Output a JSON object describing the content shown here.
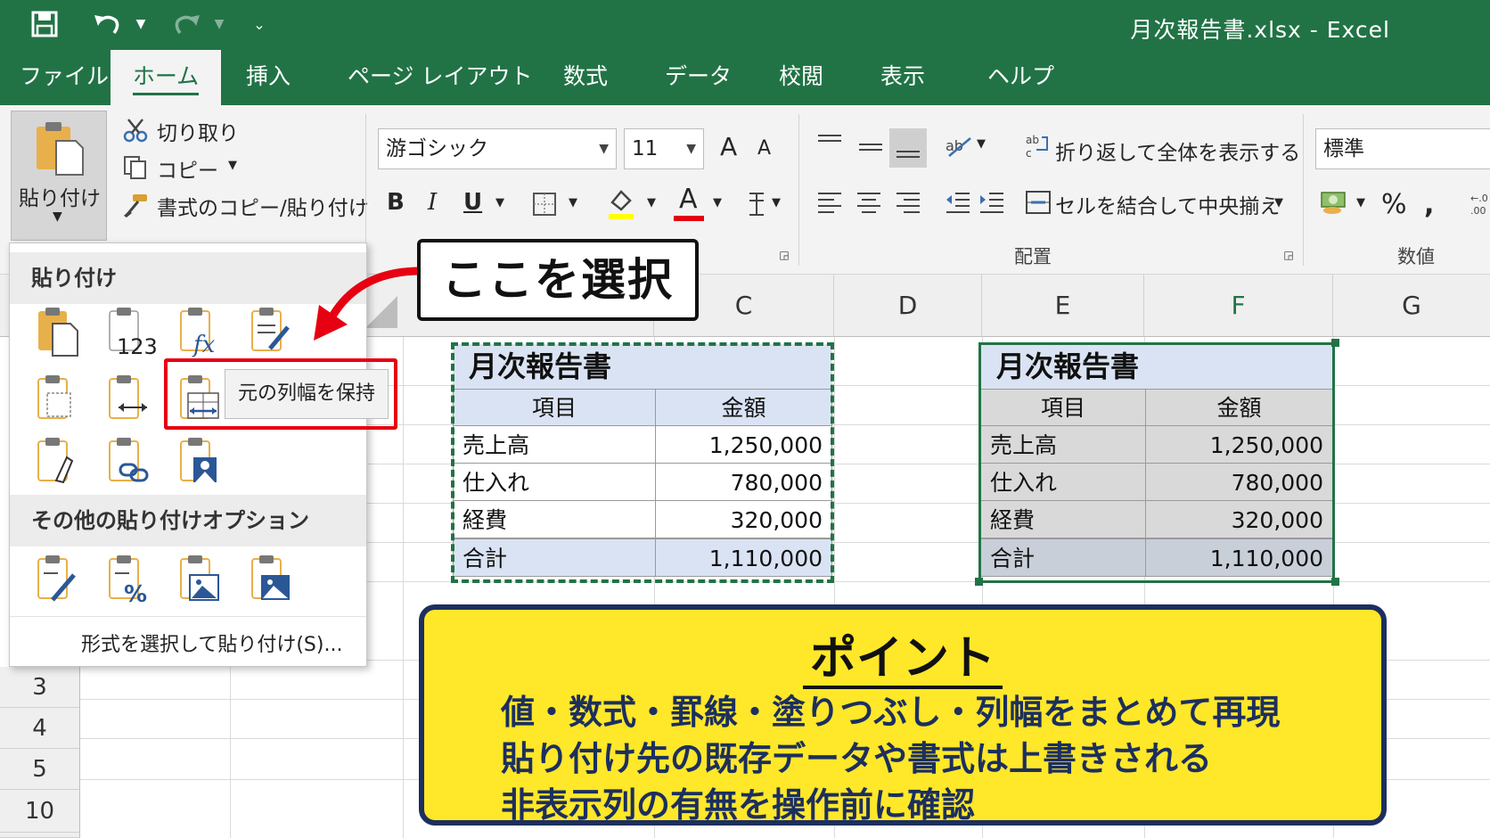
{
  "window": {
    "title": "月次報告書.xlsx  -  Excel"
  },
  "tabs": [
    {
      "label": "ファイル"
    },
    {
      "label": "ホーム"
    },
    {
      "label": "挿入"
    },
    {
      "label": "ページ レイアウト"
    },
    {
      "label": "数式"
    },
    {
      "label": "データ"
    },
    {
      "label": "校閲"
    },
    {
      "label": "表示"
    },
    {
      "label": "ヘルプ"
    }
  ],
  "ribbon": {
    "paste_label": "貼り付け",
    "cut_label": "切り取り",
    "copy_label": "コピー",
    "format_painter_label": "書式のコピー/貼り付け",
    "font_name": "游ゴシック",
    "font_size": "11",
    "bold": "B",
    "italic": "I",
    "underline": "U",
    "font_color_glyph": "A",
    "grow_font": "A",
    "shrink_font": "A",
    "wrap_text_label": "折り返して全体を表示する",
    "merge_center_label": "セルを結合して中央揃え",
    "alignment_group_label": "配置",
    "number_format": "標準",
    "percent": "%",
    "comma": "9",
    "number_group_label": "数値",
    "colors": {
      "highlight": "#ffff00",
      "font": "#e60012"
    }
  },
  "paste_menu": {
    "section1_title": "貼り付け",
    "section2_title": "その他の貼り付けオプション",
    "icon_values_text": "123",
    "icon_formula_text": "fx",
    "percent_text": "%",
    "special_link": "形式を選択して貼り付け(S)...",
    "tooltip": "元の列幅を保持"
  },
  "callout": {
    "text": "ここを選択"
  },
  "sheet": {
    "columns": [
      "C",
      "D",
      "E",
      "F",
      "G"
    ],
    "rows": [
      "3",
      "4",
      "5",
      "10"
    ]
  },
  "source_table": {
    "title": "月次報告書",
    "headers": [
      "項目",
      "金額"
    ],
    "rows": [
      {
        "item": "売上高",
        "amount": "1,250,000"
      },
      {
        "item": "仕入れ",
        "amount": "780,000"
      },
      {
        "item": "経費",
        "amount": "320,000"
      },
      {
        "item": "合計",
        "amount": "1,110,000"
      }
    ]
  },
  "dest_table": {
    "title": "月次報告書",
    "headers": [
      "項目",
      "金額"
    ],
    "rows": [
      {
        "item": "売上高",
        "amount": "1,250,000"
      },
      {
        "item": "仕入れ",
        "amount": "780,000"
      },
      {
        "item": "経費",
        "amount": "320,000"
      },
      {
        "item": "合計",
        "amount": "1,110,000"
      }
    ]
  },
  "point": {
    "title": "ポイント",
    "lines": [
      "値・数式・罫線・塗りつぶし・列幅をまとめて再現",
      "貼り付け先の既存データや書式は上書きされる",
      "非表示列の有無を操作前に確認"
    ]
  }
}
